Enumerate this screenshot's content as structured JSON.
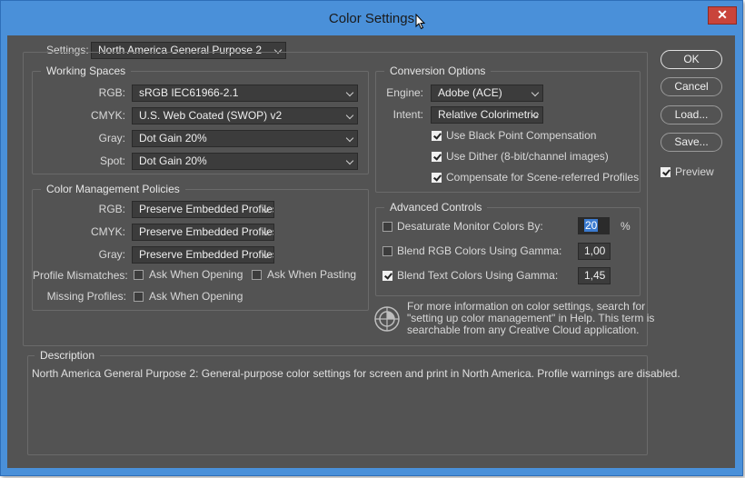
{
  "window": {
    "title": "Color Settings",
    "close_label": "✕"
  },
  "settings": {
    "label": "Settings:",
    "value": "North America General Purpose 2"
  },
  "working_spaces": {
    "title": "Working Spaces",
    "rows": [
      {
        "label": "RGB:",
        "value": "sRGB IEC61966-2.1"
      },
      {
        "label": "CMYK:",
        "value": "U.S. Web Coated (SWOP) v2"
      },
      {
        "label": "Gray:",
        "value": "Dot Gain 20%"
      },
      {
        "label": "Spot:",
        "value": "Dot Gain 20%"
      }
    ]
  },
  "policies": {
    "title": "Color Management Policies",
    "rows": [
      {
        "label": "RGB:",
        "value": "Preserve Embedded Profiles"
      },
      {
        "label": "CMYK:",
        "value": "Preserve Embedded Profiles"
      },
      {
        "label": "Gray:",
        "value": "Preserve Embedded Profiles"
      }
    ],
    "mismatch_label": "Profile Mismatches:",
    "ask_opening": "Ask When Opening",
    "ask_pasting": "Ask When Pasting",
    "missing_label": "Missing Profiles:",
    "missing_ask_opening": "Ask When Opening"
  },
  "conversion": {
    "title": "Conversion Options",
    "engine_label": "Engine:",
    "engine_value": "Adobe (ACE)",
    "intent_label": "Intent:",
    "intent_value": "Relative Colorimetric",
    "bpc": "Use Black Point Compensation",
    "dither": "Use Dither (8-bit/channel images)",
    "compensate": "Compensate for Scene-referred Profiles"
  },
  "advanced": {
    "title": "Advanced Controls",
    "desaturate": "Desaturate Monitor Colors By:",
    "desaturate_value": "20",
    "percent": "%",
    "blend_rgb": "Blend RGB Colors Using Gamma:",
    "blend_rgb_value": "1,00",
    "blend_text": "Blend Text Colors Using Gamma:",
    "blend_text_value": "1,45"
  },
  "info_text": {
    "line1": "For more information on color settings, search for",
    "line2": "\"setting up color management\" in Help. This term is",
    "line3": "searchable from any Creative Cloud application."
  },
  "description": {
    "title": "Description",
    "text": "North America General Purpose 2:  General-purpose color settings for screen and print in North America. Profile warnings are disabled."
  },
  "buttons": {
    "ok": "OK",
    "cancel": "Cancel",
    "load": "Load...",
    "save": "Save...",
    "preview": "Preview"
  },
  "colors": {
    "titlebar": "#4a90d9",
    "panel": "#535353",
    "close": "#c9443b"
  }
}
